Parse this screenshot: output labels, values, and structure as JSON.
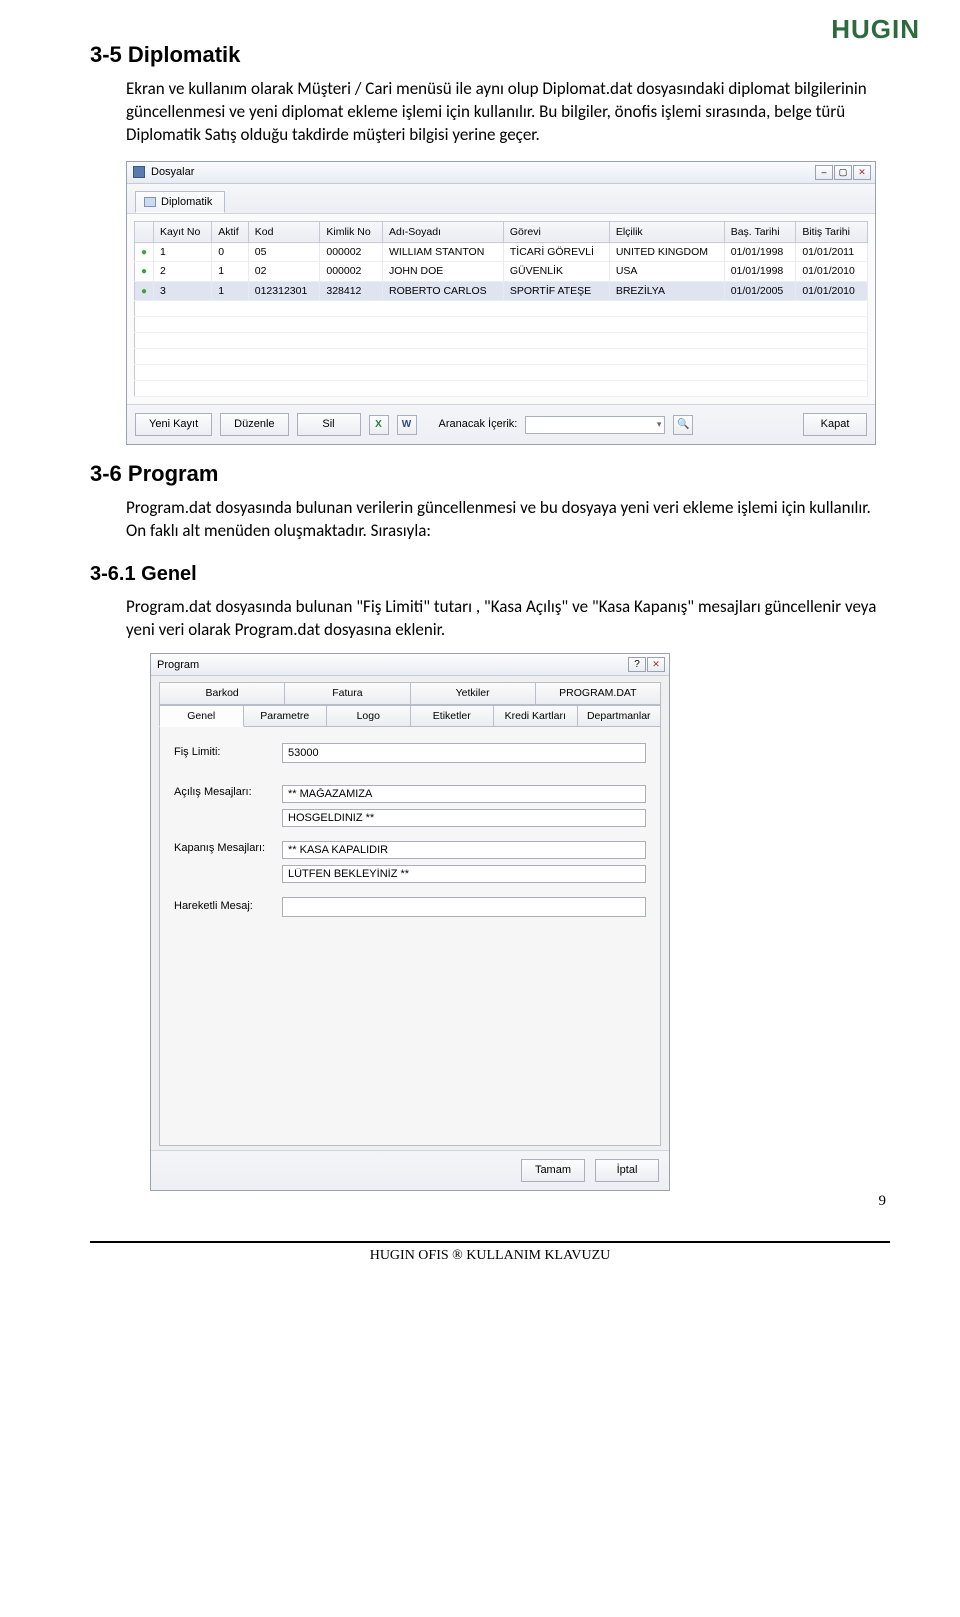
{
  "brand": "HUGIN",
  "sections": {
    "s1_heading": "3-5  Diplomatik",
    "s1_body": "Ekran ve kullanım olarak Müşteri / Cari menüsü ile aynı olup Diplomat.dat dosyasındaki diplomat bilgilerinin güncellenmesi ve yeni diplomat ekleme işlemi için kullanılır. Bu bilgiler, önofis işlemi sırasında, belge türü Diplomatik Satış olduğu takdirde müşteri bilgisi yerine geçer.",
    "s2_heading": "3-6  Program",
    "s2_body": "Program.dat dosyasında bulunan verilerin güncellenmesi ve bu dosyaya yeni veri ekleme işlemi için kullanılır. On faklı alt menüden oluşmaktadır. Sırasıyla:",
    "s3_heading": "3-6.1 Genel",
    "s3_body": "Program.dat dosyasında bulunan \"Fiş Limiti\" tutarı , \"Kasa Açılış\" ve \"Kasa Kapanış\" mesajları güncellenir veya yeni veri olarak Program.dat dosyasına eklenir."
  },
  "win1": {
    "title": "Dosyalar",
    "tab": "Diplomatik",
    "columns": [
      "Kayıt No",
      "Aktif",
      "Kod",
      "Kimlik No",
      "Adı-Soyadı",
      "Görevi",
      "Elçilik",
      "Baş. Tarihi",
      "Bitiş Tarihi"
    ],
    "rows": [
      {
        "no": "1",
        "aktif": "0",
        "kod": "05",
        "kimlik": "000002",
        "ad": "WILLIAM STANTON",
        "gorev": "TİCARİ GÖREVLİ",
        "elcilik": "UNITED KINGDOM",
        "bas": "01/01/1998",
        "bit": "01/01/2011"
      },
      {
        "no": "2",
        "aktif": "1",
        "kod": "02",
        "kimlik": "000002",
        "ad": "JOHN DOE",
        "gorev": "GÜVENLİK",
        "elcilik": "USA",
        "bas": "01/01/1998",
        "bit": "01/01/2010"
      },
      {
        "no": "3",
        "aktif": "1",
        "kod": "012312301",
        "kimlik": "328412",
        "ad": "ROBERTO CARLOS",
        "gorev": "SPORTİF ATEŞE",
        "elcilik": "BREZİLYA",
        "bas": "01/01/2005",
        "bit": "01/01/2010"
      }
    ],
    "toolbar": {
      "new": "Yeni Kayıt",
      "edit": "Düzenle",
      "del": "Sil",
      "search_label": "Aranacak İçerik:",
      "close": "Kapat"
    }
  },
  "win2": {
    "title": "Program",
    "tabs_row1": [
      "Barkod",
      "Fatura",
      "Yetkiler",
      "PROGRAM.DAT"
    ],
    "tabs_row2": [
      "Genel",
      "Parametre",
      "Logo",
      "Etiketler",
      "Kredi Kartları",
      "Departmanlar"
    ],
    "fields": {
      "fis_limiti_label": "Fiş Limiti:",
      "fis_limiti_value": "53000",
      "acilis_label": "Açılış Mesajları:",
      "acilis1": "** MAĞAZAMIZA",
      "acilis2": "HOSGELDINIZ **",
      "kapanis_label": "Kapanış Mesajları:",
      "kapanis1": "** KASA KAPALIDIR",
      "kapanis2": "LÜTFEN BEKLEYİNİZ **",
      "hareketli_label": "Hareketli Mesaj:",
      "hareketli_value": ""
    },
    "buttons": {
      "ok": "Tamam",
      "cancel": "İptal"
    }
  },
  "footer": "HUGIN OFIS ® KULLANIM KLAVUZU",
  "page_num": "9"
}
